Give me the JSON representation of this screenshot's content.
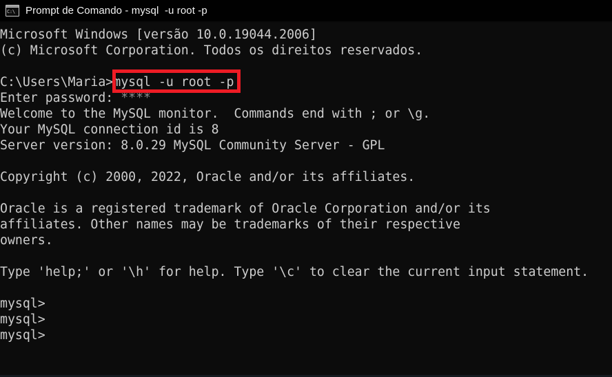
{
  "window": {
    "titlebar": {
      "icon": "console-cmd-icon",
      "icon_glyph": "C:\\",
      "title": "Prompt de Comando - mysql  -u root -p"
    },
    "background_color": "#0c0c0c",
    "text_color": "#cdcdcd"
  },
  "annotation": {
    "type": "rectangle-highlight",
    "color": "#ee1c25",
    "target_text": "mysql -u root -p"
  },
  "terminal": {
    "lines": [
      {
        "text": "Microsoft Windows [versão 10.0.19044.2006]"
      },
      {
        "text": "(c) Microsoft Corporation. Todos os direitos reservados."
      },
      {
        "text": ""
      },
      {
        "text": "C:\\Users\\Maria>mysql -u root -p"
      },
      {
        "text": "Enter password: ",
        "suffix": "****",
        "suffix_dim": true
      },
      {
        "text": "Welcome to the MySQL monitor.  Commands end with ; or \\g."
      },
      {
        "text": "Your MySQL connection id is 8"
      },
      {
        "text": "Server version: 8.0.29 MySQL Community Server - GPL"
      },
      {
        "text": ""
      },
      {
        "text": "Copyright (c) 2000, 2022, Oracle and/or its affiliates."
      },
      {
        "text": ""
      },
      {
        "text": "Oracle is a registered trademark of Oracle Corporation and/or its"
      },
      {
        "text": "affiliates. Other names may be trademarks of their respective"
      },
      {
        "text": "owners."
      },
      {
        "text": ""
      },
      {
        "text": "Type 'help;' or '\\h' for help. Type '\\c' to clear the current input statement."
      },
      {
        "text": ""
      },
      {
        "text": "mysql>"
      },
      {
        "text": "mysql>"
      },
      {
        "text": "mysql>"
      }
    ],
    "line_refs": {
      "l0": "Microsoft Windows [versão 10.0.19044.2006]",
      "l1": "(c) Microsoft Corporation. Todos os direitos reservados.",
      "l3": "C:\\Users\\Maria>mysql -u root -p",
      "l4_prefix": "Enter password: ",
      "l4_masked": "****",
      "l5": "Welcome to the MySQL monitor.  Commands end with ; or \\g.",
      "l6": "Your MySQL connection id is 8",
      "l7": "Server version: 8.0.29 MySQL Community Server - GPL",
      "l9": "Copyright (c) 2000, 2022, Oracle and/or its affiliates.",
      "l11": "Oracle is a registered trademark of Oracle Corporation and/or its",
      "l12": "affiliates. Other names may be trademarks of their respective",
      "l13": "owners.",
      "l15": "Type 'help;' or '\\h' for help. Type '\\c' to clear the current input statement.",
      "l17": "mysql>",
      "l18": "mysql>",
      "l19": "mysql>"
    }
  }
}
